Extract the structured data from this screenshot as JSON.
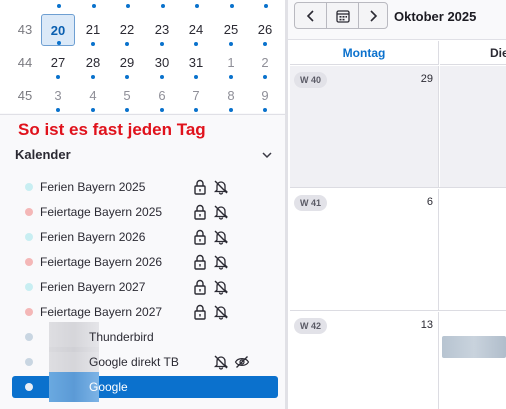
{
  "mini_calendar": {
    "rows": [
      {
        "week": "43",
        "days": [
          {
            "label": "20",
            "today": true,
            "other": false
          },
          {
            "label": "21",
            "today": false,
            "other": false
          },
          {
            "label": "22",
            "today": false,
            "other": false
          },
          {
            "label": "23",
            "today": false,
            "other": false
          },
          {
            "label": "24",
            "today": false,
            "other": false
          },
          {
            "label": "25",
            "today": false,
            "other": false
          },
          {
            "label": "26",
            "today": false,
            "other": false
          }
        ]
      },
      {
        "week": "44",
        "days": [
          {
            "label": "27",
            "today": false,
            "other": false
          },
          {
            "label": "28",
            "today": false,
            "other": false
          },
          {
            "label": "29",
            "today": false,
            "other": false
          },
          {
            "label": "30",
            "today": false,
            "other": false
          },
          {
            "label": "31",
            "today": false,
            "other": false
          },
          {
            "label": "1",
            "today": false,
            "other": true
          },
          {
            "label": "2",
            "today": false,
            "other": true
          }
        ]
      },
      {
        "week": "45",
        "days": [
          {
            "label": "3",
            "today": false,
            "other": true
          },
          {
            "label": "4",
            "today": false,
            "other": true
          },
          {
            "label": "5",
            "today": false,
            "other": true
          },
          {
            "label": "6",
            "today": false,
            "other": true
          },
          {
            "label": "7",
            "today": false,
            "other": true
          },
          {
            "label": "8",
            "today": false,
            "other": true
          },
          {
            "label": "9",
            "today": false,
            "other": true
          }
        ]
      }
    ]
  },
  "annotation": "So ist es fast jeden Tag",
  "calendars": {
    "title": "Kalender",
    "items": [
      {
        "label": "Ferien Bayern 2025",
        "color": "#c8eef2",
        "locked": true,
        "alarm_off": true,
        "hidden": false,
        "selected": false
      },
      {
        "label": "Feiertage Bayern 2025",
        "color": "#f4b7b7",
        "locked": true,
        "alarm_off": true,
        "hidden": false,
        "selected": false
      },
      {
        "label": "Ferien Bayern 2026",
        "color": "#c8eef2",
        "locked": true,
        "alarm_off": true,
        "hidden": false,
        "selected": false
      },
      {
        "label": "Feiertage Bayern 2026",
        "color": "#f4b7b7",
        "locked": true,
        "alarm_off": true,
        "hidden": false,
        "selected": false
      },
      {
        "label": "Ferien Bayern 2027",
        "color": "#c8eef2",
        "locked": true,
        "alarm_off": true,
        "hidden": false,
        "selected": false
      },
      {
        "label": "Feiertage Bayern 2027",
        "color": "#f4b7b7",
        "locked": true,
        "alarm_off": true,
        "hidden": false,
        "selected": false
      },
      {
        "label": "Thunderbird",
        "color": "#c9d6e2",
        "locked": false,
        "alarm_off": false,
        "hidden": false,
        "selected": false
      },
      {
        "label": "Google direkt TB",
        "color": "#c9d6e2",
        "locked": false,
        "alarm_off": true,
        "hidden": true,
        "selected": false
      },
      {
        "label": "Google",
        "color": "#e8eef6",
        "locked": false,
        "alarm_off": false,
        "hidden": false,
        "selected": true
      }
    ]
  },
  "header": {
    "month": "Oktober 2025"
  },
  "columns": {
    "monday": "Montag",
    "tuesday": "Dienstag"
  },
  "weeks": [
    {
      "badge": "W 40",
      "day": "29"
    },
    {
      "badge": "W 41",
      "day": "6"
    },
    {
      "badge": "W 42",
      "day": "13"
    }
  ]
}
